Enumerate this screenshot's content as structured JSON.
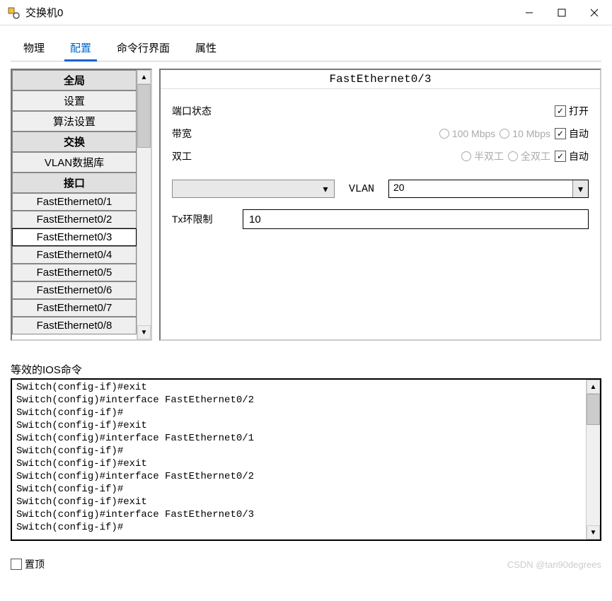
{
  "window": {
    "title": "交换机0"
  },
  "tabs": [
    "物理",
    "配置",
    "命令行界面",
    "属性"
  ],
  "active_tab": "配置",
  "sidebar": {
    "sections": [
      {
        "header": "全局",
        "items": [
          "设置",
          "算法设置"
        ]
      },
      {
        "header": "交换",
        "items": [
          "VLAN数据库"
        ]
      },
      {
        "header": "接口",
        "items": [
          "FastEthernet0/1",
          "FastEthernet0/2",
          "FastEthernet0/3",
          "FastEthernet0/4",
          "FastEthernet0/5",
          "FastEthernet0/6",
          "FastEthernet0/7",
          "FastEthernet0/8"
        ]
      }
    ],
    "selected": "FastEthernet0/3"
  },
  "detail": {
    "title": "FastEthernet0/3",
    "port_status_label": "端口状态",
    "port_on_label": "打开",
    "port_on": true,
    "bandwidth_label": "带宽",
    "bw_100": "100 Mbps",
    "bw_10": "10 Mbps",
    "bw_auto_label": "自动",
    "bw_auto": true,
    "duplex_label": "双工",
    "dup_half": "半双工",
    "dup_full": "全双工",
    "dup_auto_label": "自动",
    "dup_auto": true,
    "vlan_label": "VLAN",
    "vlan_value": "20",
    "tx_label": "Tx环限制",
    "tx_value": "10"
  },
  "ios": {
    "label": "等效的IOS命令",
    "lines": [
      "Switch(config-if)#exit",
      "Switch(config)#interface FastEthernet0/2",
      "Switch(config-if)#",
      "Switch(config-if)#exit",
      "Switch(config)#interface FastEthernet0/1",
      "Switch(config-if)#",
      "Switch(config-if)#exit",
      "Switch(config)#interface FastEthernet0/2",
      "Switch(config-if)#",
      "Switch(config-if)#exit",
      "Switch(config)#interface FastEthernet0/3",
      "Switch(config-if)#"
    ]
  },
  "bottom": {
    "top_label": "置顶",
    "watermark": "CSDN @tan90degrees"
  }
}
